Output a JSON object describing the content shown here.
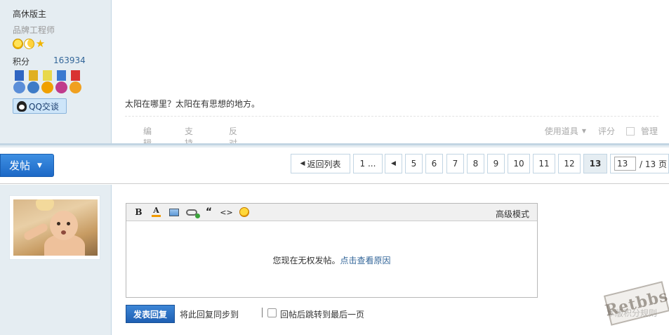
{
  "user": {
    "name": "高休版主",
    "title": "品牌工程师",
    "points_label": "积分",
    "points_value": "163934",
    "qq_label": "QQ交谈",
    "medal_colors": [
      {
        "ribbon": "#2f65c2",
        "disk": "#5b8ed8"
      },
      {
        "ribbon": "#e0b020",
        "disk": "#3e7cc7"
      },
      {
        "ribbon": "#e8d84a",
        "disk": "#f0a000"
      },
      {
        "ribbon": "#3a7ad0",
        "disk": "#c03b8c"
      },
      {
        "ribbon": "#d93232",
        "disk": "#f0a020"
      }
    ]
  },
  "post": {
    "text": "太阳在哪里？太阳在有思想的地方。",
    "actions": {
      "edit": "编辑",
      "support": "支持",
      "oppose": "反对",
      "use_tool": "使用道具",
      "rate": "评分",
      "manage": "管理"
    }
  },
  "toolbar": {
    "post_button": "发帖",
    "back_to_list": "返回列表",
    "first_page": "1 ...",
    "pages": [
      "5",
      "6",
      "7",
      "8",
      "9",
      "10",
      "11",
      "12",
      "13"
    ],
    "current_page": "13",
    "page_input": "13",
    "page_total": "/ 13 页"
  },
  "reply": {
    "advanced_mode": "高级模式",
    "no_permission": "您现在无权发帖。",
    "view_reason": "点击查看原因",
    "submit": "发表回复",
    "sync_label": "将此回复同步到",
    "jump_label": "回帖后跳转到最后一页",
    "rules": "本版积分规则",
    "watermark": "Retbbs"
  },
  "colors": {
    "sidebar_bg": "#e5edf2",
    "border_blue": "#c2d5e3",
    "link_blue": "#336699",
    "button_blue": "#1e5fb3"
  }
}
